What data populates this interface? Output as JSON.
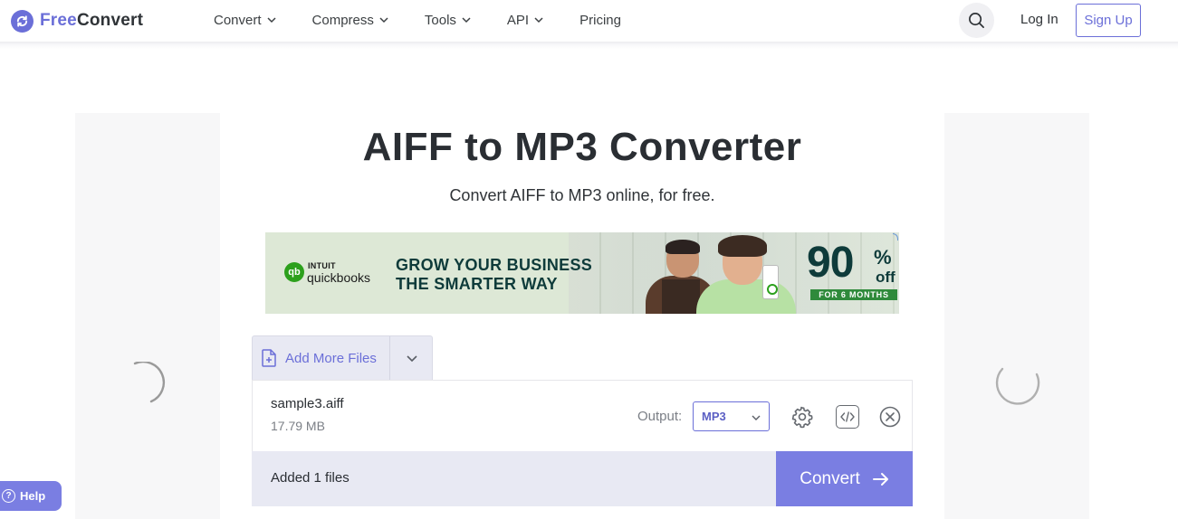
{
  "header": {
    "logo": {
      "part1": "Free",
      "part2": "Convert",
      "icon": "refresh-icon"
    },
    "nav": [
      {
        "label": "Convert",
        "has_dropdown": true
      },
      {
        "label": "Compress",
        "has_dropdown": true
      },
      {
        "label": "Tools",
        "has_dropdown": true
      },
      {
        "label": "API",
        "has_dropdown": true
      },
      {
        "label": "Pricing",
        "has_dropdown": false
      }
    ],
    "search_icon": "search-icon",
    "login_label": "Log In",
    "signup_label": "Sign Up"
  },
  "main": {
    "title": "AIFF to MP3 Converter",
    "subtitle": "Convert AIFF to MP3 online, for free."
  },
  "ad": {
    "brand_small": "INTUIT",
    "brand_name": "quickbooks",
    "headline1": "GROW YOUR  BUSINESS",
    "headline2": "THE SMARTER WAY",
    "percent": "90",
    "percent_sign": "%",
    "off": "off",
    "band": "FOR 6 MONTHS"
  },
  "uploader": {
    "add_more_label": "Add More Files",
    "file": {
      "name": "sample3.aiff",
      "size": "17.79 MB"
    },
    "output_label": "Output:",
    "output_value": "MP3",
    "added_text": "Added 1 files",
    "convert_label": "Convert"
  },
  "help": {
    "label": "Help"
  },
  "colors": {
    "accent": "#6b6fd8",
    "convert_button": "#7a7ee2",
    "panel_bg": "#e8e9f3",
    "ad_green": "#2ca01c",
    "ad_text": "#0e3b3a"
  }
}
